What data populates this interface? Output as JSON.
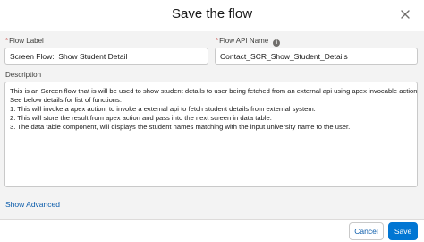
{
  "modal": {
    "title": "Save the flow"
  },
  "form": {
    "flow_label": {
      "label": "Flow Label",
      "value": "Screen Flow:  Show Student Detail"
    },
    "flow_api_name": {
      "label": "Flow API Name",
      "value": "Contact_SCR_Show_Student_Details"
    },
    "description": {
      "label": "Description",
      "lines": [
        "This is an Screen flow that is will be used to show student details to user being fetched from an external api using apex invocable action.",
        "See below details for list of functions.",
        "1. This will invoke a apex action, to invoke a external api to fetch student details from external system.",
        "2. This will store the result from apex action and pass into the next screen in data table.",
        "3. The data table component, will displays the student names matching with the input university name to the user."
      ]
    },
    "show_advanced": "Show Advanced"
  },
  "footer": {
    "cancel_label": "Cancel",
    "save_label": "Save"
  }
}
